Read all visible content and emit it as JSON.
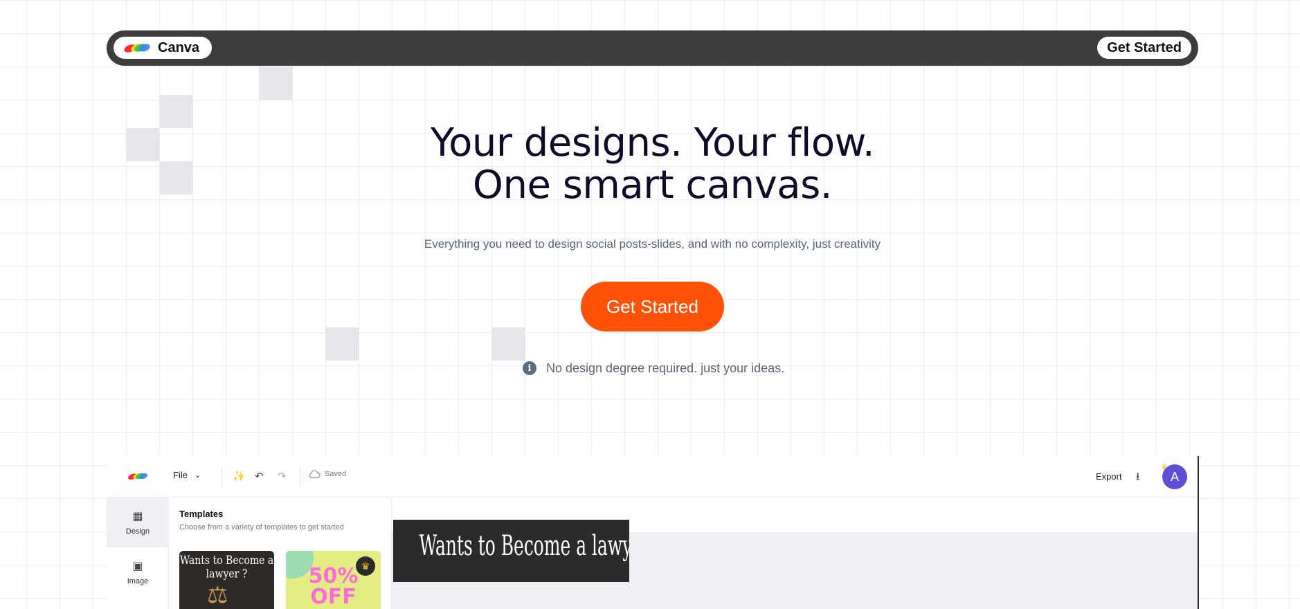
{
  "nav": {
    "brand": "Canva",
    "cta_label": "Get Started"
  },
  "hero": {
    "title_line1": "Your designs. Your flow.",
    "title_line2": "One smart canvas.",
    "subtitle": "Everything you need to design social posts-slides, and with no complexity, just creativity",
    "cta_label": "Get Started",
    "note": "No design degree required. just your ideas."
  },
  "editor": {
    "file_menu": "File",
    "status": "Saved",
    "export_label": "Export",
    "avatar_initial": "A",
    "rail": [
      {
        "label": "Design",
        "icon": "layout-icon"
      },
      {
        "label": "Image",
        "icon": "image-icon"
      }
    ],
    "panel": {
      "title": "Templates",
      "subtitle": "Choose from a variety of templates to get started"
    },
    "templates": [
      {
        "text": "Wants to Become a lawyer ?"
      },
      {
        "text_line1": "50%",
        "text_line2": "OFF",
        "premium": true
      }
    ],
    "canvas_card_text": "Wants to Become a lawyer ?"
  },
  "colors": {
    "accent": "#ff5208",
    "nav_bg": "#3d3d3d",
    "avatar": "#5e4fd6"
  }
}
